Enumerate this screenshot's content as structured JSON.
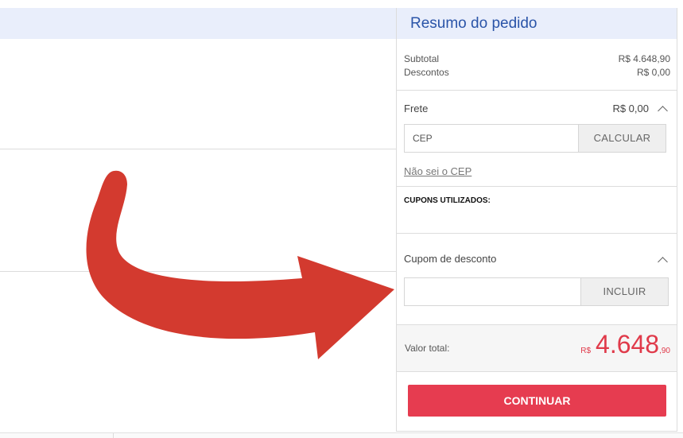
{
  "summary": {
    "title": "Resumo do pedido",
    "subtotal_label": "Subtotal",
    "subtotal_value": "R$ 4.648,90",
    "discounts_label": "Descontos",
    "discounts_value": "R$ 0,00",
    "shipping_label": "Frete",
    "shipping_value": "R$ 0,00",
    "cep_placeholder": "CEP",
    "calc_button": "CALCULAR",
    "unknown_cep_link": "Não sei o CEP",
    "coupons_used_label": "CUPONS UTILIZADOS:",
    "coupon_label": "Cupom de desconto",
    "coupon_value": "",
    "include_button": "INCLUIR",
    "total_label": "Valor total:",
    "total_currency": "R$",
    "total_integer": "4.648",
    "total_decimal": ",90",
    "continue_button": "CONTINUAR"
  },
  "colors": {
    "accent": "#2a54a8",
    "cta": "#e63c50",
    "price": "#e03a4a",
    "arrow": "#d33a2f",
    "header_band": "#e9eefb"
  },
  "icons": {
    "shipping_toggle": "chevron-up-icon",
    "coupon_toggle": "chevron-up-icon",
    "annotation": "curved-arrow"
  }
}
